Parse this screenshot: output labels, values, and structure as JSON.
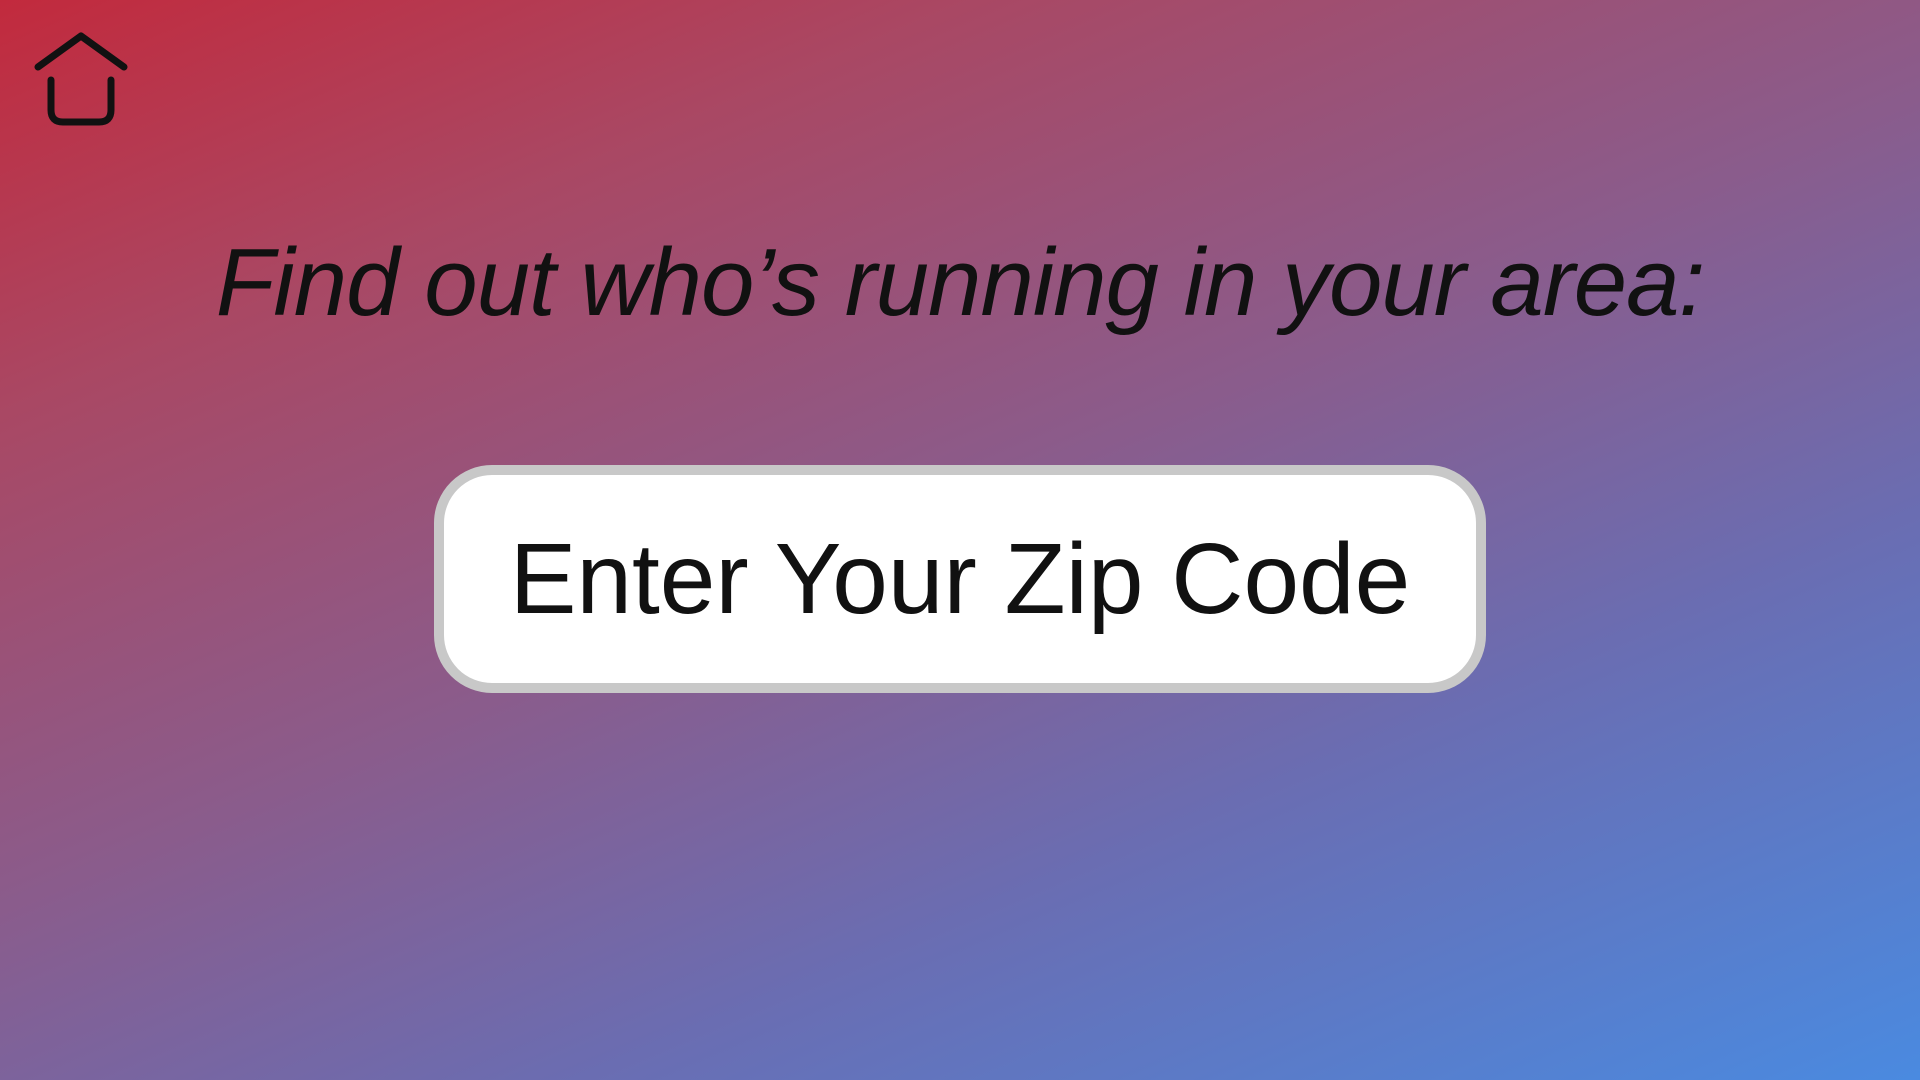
{
  "header": {
    "home_icon": "home-icon"
  },
  "main": {
    "headline": "Find out who’s running in your area:",
    "zip_input": {
      "placeholder": "Enter Your Zip Code",
      "value": ""
    }
  },
  "colors": {
    "gradient_top_right": "#c22a3d",
    "gradient_bottom_left": "#4a8ae0",
    "input_border": "#c8c8c8",
    "text": "#111111"
  }
}
